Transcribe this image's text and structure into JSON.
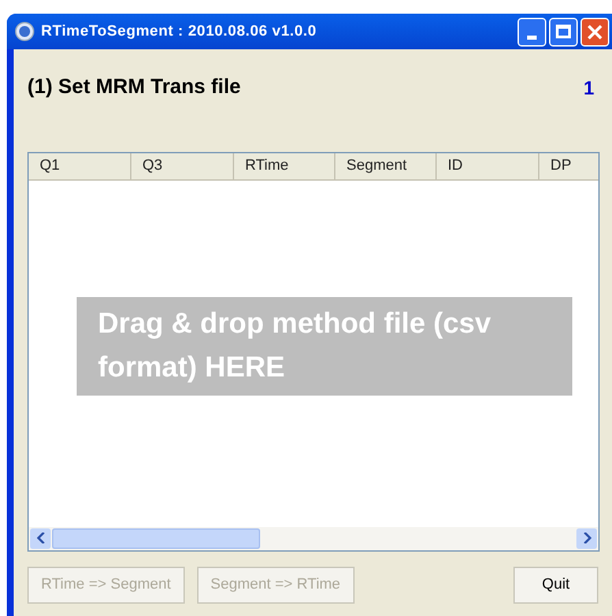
{
  "window": {
    "title": "RTimeToSegment : 2010.08.06 v1.0.0"
  },
  "step": {
    "title": "(1) Set MRM Trans file",
    "number": "1"
  },
  "table": {
    "columns": [
      "Q1",
      "Q3",
      "RTime",
      "Segment",
      "ID",
      "DP"
    ]
  },
  "drop_hint": "Drag & drop method file (csv format) HERE",
  "buttons": [
    {
      "label": "RTime => Segment",
      "disabled": true
    },
    {
      "label": "Segment => RTime",
      "disabled": true
    },
    {
      "label": "Quit",
      "disabled": false
    }
  ]
}
